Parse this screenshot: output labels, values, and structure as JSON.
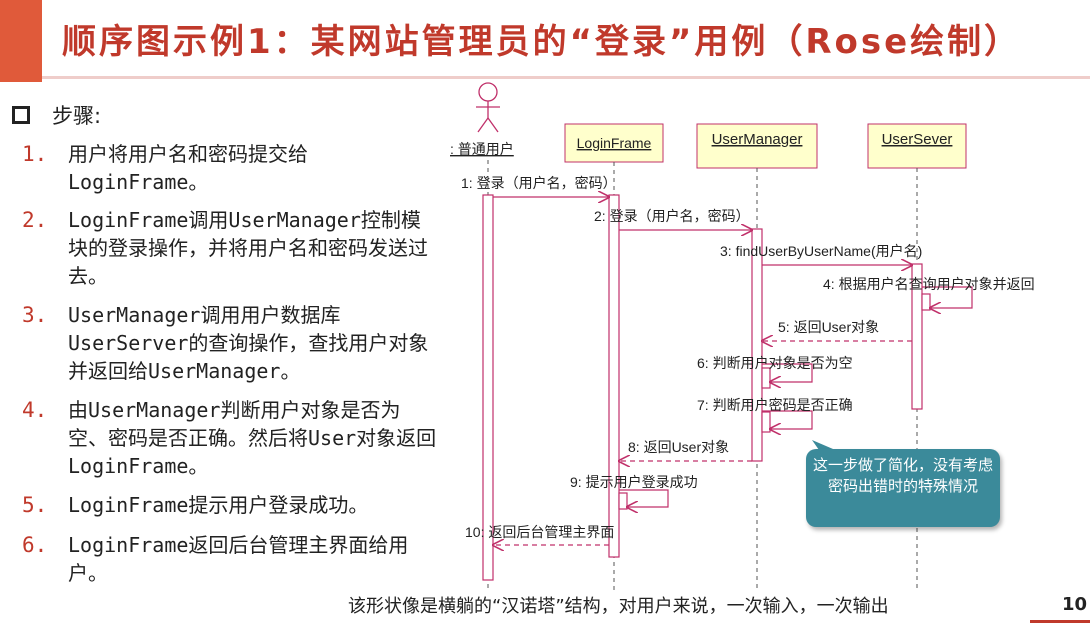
{
  "title": "顺序图示例1：某网站管理员的“登录”用例（Rose绘制）",
  "steps_heading": "步骤:",
  "steps": [
    {
      "num": "1.",
      "text": "用户将用户名和密码提交给LoginFrame。"
    },
    {
      "num": "2.",
      "text": "LoginFrame调用UserManager控制模块的登录操作，并将用户名和密码发送过去。"
    },
    {
      "num": "3.",
      "text": "UserManager调用用户数据库UserServer的查询操作，查找用户对象并返回给UserManager。"
    },
    {
      "num": "4.",
      "text": "由UserManager判断用户对象是否为空、密码是否正确。然后将User对象返回LoginFrame。"
    },
    {
      "num": "5.",
      "text": "LoginFrame提示用户登录成功。"
    },
    {
      "num": "6.",
      "text": "LoginFrame返回后台管理主界面给用户。"
    }
  ],
  "diagram": {
    "actor": ": 普通用户",
    "objects": [
      "LoginFrame",
      "UserManager",
      "UserSever"
    ],
    "messages": [
      "1: 登录（用户名，密码）",
      "2: 登录（用户名，密码）",
      "3: findUserByUserName(用户名)",
      "4: 根据用户名查询用户对象并返回",
      "5: 返回User对象",
      "6: 判断用户对象是否为空",
      "7: 判断用户密码是否正确",
      "8: 返回User对象",
      "9: 提示用户登录成功",
      "10: 返回后台管理主界面"
    ],
    "callout": "这一步做了简化，没有考虑密码出错时的特殊情况"
  },
  "footer": "该形状像是横躺的“汉诺塔”结构，对用户来说，一次输入，一次输出",
  "page_number": "10",
  "colors": {
    "accent": "#e05a3a",
    "title": "#c0392b",
    "lifeline": "#c0306a",
    "object_fill": "#ffffcc",
    "callout": "#3b8a9a"
  }
}
